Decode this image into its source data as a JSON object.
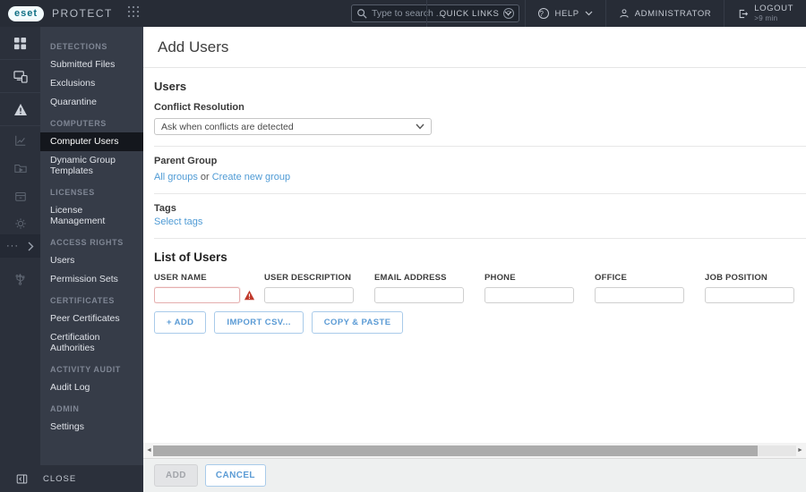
{
  "topbar": {
    "logo_text": "eset",
    "product": "PROTECT",
    "search": {
      "placeholder": "Type to search ..."
    },
    "quick_links_label": "QUICK LINKS",
    "help_label": "HELP",
    "user_label": "ADMINISTRATOR",
    "logout": {
      "label": "LOGOUT",
      "timer": ">9 min"
    }
  },
  "sidebar": {
    "rail_icons": [
      "dashboard",
      "computers",
      "detections",
      "reports",
      "tasks",
      "installers",
      "policies",
      "notifications",
      "integrations"
    ],
    "more_glyph": "···",
    "sections": [
      {
        "header": "DETECTIONS",
        "items": [
          {
            "label": "Submitted Files"
          },
          {
            "label": "Exclusions"
          },
          {
            "label": "Quarantine"
          }
        ]
      },
      {
        "header": "COMPUTERS",
        "items": [
          {
            "label": "Computer Users",
            "active": true
          },
          {
            "label": "Dynamic Group Templates"
          }
        ]
      },
      {
        "header": "LICENSES",
        "items": [
          {
            "label": "License Management"
          }
        ]
      },
      {
        "header": "ACCESS RIGHTS",
        "items": [
          {
            "label": "Users"
          },
          {
            "label": "Permission Sets"
          }
        ]
      },
      {
        "header": "CERTIFICATES",
        "items": [
          {
            "label": "Peer Certificates"
          },
          {
            "label": "Certification Authorities"
          }
        ]
      },
      {
        "header": "ACTIVITY AUDIT",
        "items": [
          {
            "label": "Audit Log"
          }
        ]
      },
      {
        "header": "ADMIN",
        "items": [
          {
            "label": "Settings"
          }
        ]
      }
    ],
    "close_label": "CLOSE"
  },
  "page": {
    "title": "Add Users",
    "users_section": {
      "heading": "Users",
      "conflict_label": "Conflict Resolution",
      "conflict_value": "Ask when conflicts are detected"
    },
    "parent_group": {
      "heading": "Parent Group",
      "link_all_groups": "All groups",
      "or_word": "or",
      "link_create_new": "Create new group"
    },
    "tags_section": {
      "heading": "Tags",
      "link_select_tags": "Select tags"
    },
    "list_of_users": {
      "heading": "List of Users",
      "columns": [
        "USER NAME",
        "USER DESCRIPTION",
        "EMAIL ADDRESS",
        "PHONE",
        "OFFICE",
        "JOB POSITION"
      ],
      "row_values": [
        "",
        "",
        "",
        "",
        "",
        ""
      ],
      "error_column_index": 0,
      "buttons": {
        "add": "+ ADD",
        "import_csv": "IMPORT CSV...",
        "copy_paste": "COPY & PASTE"
      }
    },
    "footer": {
      "add": "ADD",
      "cancel": "CANCEL"
    }
  },
  "colors": {
    "topbar_bg": "#272c36",
    "rail_bg": "#2b303b",
    "menu_bg": "#363c48",
    "active_item_bg": "#14171d",
    "link_blue": "#4f9bd5",
    "button_blue_border": "#a9cbea",
    "error_red": "#c0392b",
    "error_border": "#e5aeae"
  }
}
